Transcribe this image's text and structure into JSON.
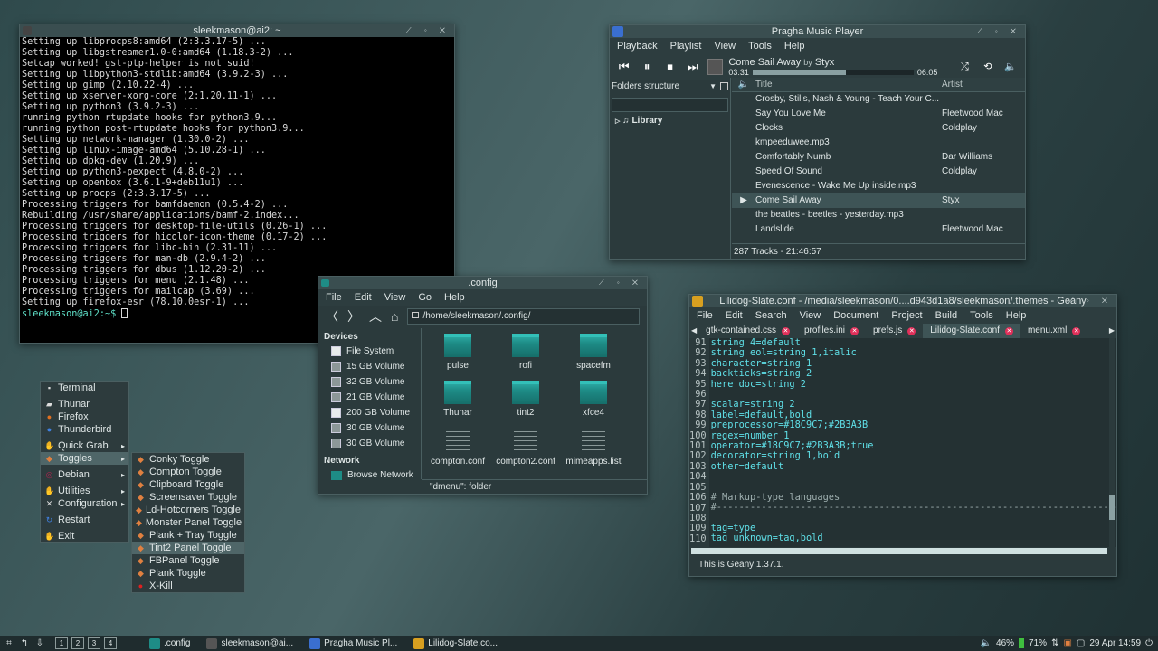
{
  "terminal": {
    "title": "sleekmason@ai2: ~",
    "lines": [
      "Setting up libprocps8:amd64 (2:3.3.17-5) ...",
      "Setting up libgstreamer1.0-0:amd64 (1.18.3-2) ...",
      "Setcap worked! gst-ptp-helper is not suid!",
      "Setting up libpython3-stdlib:amd64 (3.9.2-3) ...",
      "Setting up gimp (2.10.22-4) ...",
      "Setting up xserver-xorg-core (2:1.20.11-1) ...",
      "Setting up python3 (3.9.2-3) ...",
      "running python rtupdate hooks for python3.9...",
      "running python post-rtupdate hooks for python3.9...",
      "Setting up network-manager (1.30.0-2) ...",
      "Setting up linux-image-amd64 (5.10.28-1) ...",
      "Setting up dpkg-dev (1.20.9) ...",
      "Setting up python3-pexpect (4.8.0-2) ...",
      "Setting up openbox (3.6.1-9+deb11u1) ...",
      "Setting up procps (2:3.3.17-5) ...",
      "Processing triggers for bamfdaemon (0.5.4-2) ...",
      "Rebuilding /usr/share/applications/bamf-2.index...",
      "Processing triggers for desktop-file-utils (0.26-1) ...",
      "Processing triggers for hicolor-icon-theme (0.17-2) ...",
      "Processing triggers for libc-bin (2.31-11) ...",
      "Processing triggers for man-db (2.9.4-2) ...",
      "Processing triggers for dbus (1.12.20-2) ...",
      "Processing triggers for menu (2.1.48) ...",
      "Processing triggers for mailcap (3.69) ...",
      "Setting up firefox-esr (78.10.0esr-1) ..."
    ],
    "prompt": "sleekmason@ai2:~$"
  },
  "music": {
    "title": "Pragha Music Player",
    "menu": [
      "Playback",
      "Playlist",
      "View",
      "Tools",
      "Help"
    ],
    "now_title": "Come Sail Away",
    "now_by": "by",
    "now_artist": "Styx",
    "elapsed": "03:31",
    "total": "06:05",
    "progress": 0.58,
    "side_label": "Folders structure",
    "library": "Library",
    "col_title": "Title",
    "col_artist": "Artist",
    "tracks": [
      {
        "title": "Crosby, Stills, Nash & Young - Teach Your C...",
        "artist": ""
      },
      {
        "title": "Say You Love Me",
        "artist": "Fleetwood Mac"
      },
      {
        "title": "Clocks",
        "artist": "Coldplay"
      },
      {
        "title": "kmpeeduwee.mp3",
        "artist": ""
      },
      {
        "title": "Comfortably Numb",
        "artist": "Dar Williams"
      },
      {
        "title": "Speed Of Sound",
        "artist": "Coldplay"
      },
      {
        "title": "Evenescence - Wake Me Up inside.mp3",
        "artist": ""
      },
      {
        "title": "Come Sail Away",
        "artist": "Styx"
      },
      {
        "title": "the beatles - beetles - yesterday.mp3",
        "artist": ""
      },
      {
        "title": "Landslide",
        "artist": "Fleetwood Mac"
      }
    ],
    "playing_index": 7,
    "status": "287 Tracks - 21:46:57"
  },
  "files": {
    "title": ".config",
    "menu": [
      "File",
      "Edit",
      "View",
      "Go",
      "Help"
    ],
    "path": "/home/sleekmason/.config/",
    "devices_header": "Devices",
    "devices": [
      "File System",
      "15 GB Volume",
      "32 GB Volume",
      "21 GB Volume",
      "200 GB Volume",
      "30 GB Volume",
      "30 GB Volume"
    ],
    "network_header": "Network",
    "network_item": "Browse Network",
    "items": [
      {
        "name": "pulse",
        "kind": "folder"
      },
      {
        "name": "rofi",
        "kind": "folder"
      },
      {
        "name": "spacefm",
        "kind": "folder"
      },
      {
        "name": "Thunar",
        "kind": "folder"
      },
      {
        "name": "tint2",
        "kind": "folder"
      },
      {
        "name": "xfce4",
        "kind": "folder"
      },
      {
        "name": "compton.conf",
        "kind": "file"
      },
      {
        "name": "compton2.conf",
        "kind": "file"
      },
      {
        "name": "mimeapps.list",
        "kind": "file"
      }
    ],
    "status": "\"dmenu\": folder"
  },
  "geany": {
    "title": "Lilidog-Slate.conf - /media/sleekmason/0....d943d1a8/sleekmason/.themes - Geany",
    "menu": [
      "File",
      "Edit",
      "Search",
      "View",
      "Document",
      "Project",
      "Build",
      "Tools",
      "Help"
    ],
    "tabs": [
      "gtk-contained.css",
      "profiles.ini",
      "prefs.js",
      "Lilidog-Slate.conf",
      "menu.xml"
    ],
    "active_tab": 3,
    "line_numbers": [
      "91",
      "92",
      "93",
      "94",
      "95",
      "96",
      "97",
      "98",
      "99",
      "100",
      "101",
      "102",
      "103",
      "104",
      "105",
      "106",
      "107",
      "108",
      "109",
      "110"
    ],
    "code": [
      "string 4=default",
      "string eol=string 1,italic",
      "character=string 1",
      "backticks=string 2",
      "here doc=string 2",
      "",
      "scalar=string 2",
      "label=default,bold",
      "preprocessor=#18C9C7;#2B3A3B",
      "regex=number 1",
      "operator=#18C9C7;#2B3A3B;true",
      "decorator=string 1,bold",
      "other=default",
      "",
      "",
      "# Markup-type languages",
      "#-----------------------------------------------------------------------------------",
      "",
      "tag=type",
      "tag unknown=tag,bold"
    ],
    "status": "This is Geany 1.37.1."
  },
  "rootmenu": {
    "items": [
      {
        "label": "Terminal",
        "icon": "terminal-icon",
        "submenu": false,
        "sep_after": true
      },
      {
        "label": "Thunar",
        "icon": "file-manager-icon",
        "submenu": false,
        "sep_after": false
      },
      {
        "label": "Firefox",
        "icon": "firefox-icon",
        "submenu": false,
        "sep_after": false
      },
      {
        "label": "Thunderbird",
        "icon": "thunderbird-icon",
        "submenu": false,
        "sep_after": true
      },
      {
        "label": "Quick Grab",
        "icon": "grab-icon",
        "submenu": true,
        "sep_after": false
      },
      {
        "label": "Toggles",
        "icon": "toggle-icon",
        "submenu": true,
        "sep_after": true,
        "selected": true
      },
      {
        "label": "Debian",
        "icon": "debian-icon",
        "submenu": true,
        "sep_after": true
      },
      {
        "label": "Utilities",
        "icon": "utilities-icon",
        "submenu": true,
        "sep_after": false
      },
      {
        "label": "Configuration",
        "icon": "configuration-icon",
        "submenu": true,
        "sep_after": true
      },
      {
        "label": "Restart",
        "icon": "restart-icon",
        "submenu": false,
        "sep_after": true
      },
      {
        "label": "Exit",
        "icon": "exit-icon",
        "submenu": false,
        "sep_after": false
      }
    ],
    "toggles": [
      "Conky Toggle",
      "Compton Toggle",
      "Clipboard Toggle",
      "Screensaver Toggle",
      "Ld-Hotcorners Toggle",
      "Monster Panel Toggle",
      "Plank + Tray Toggle",
      "Tint2 Panel Toggle",
      "FBPanel Toggle",
      "Plank Toggle",
      "X-Kill"
    ],
    "toggle_selected": 7
  },
  "taskbar": {
    "desktops": [
      "1",
      "2",
      "3",
      "4"
    ],
    "tasks": [
      {
        "label": ".config",
        "color": "#1e8c86"
      },
      {
        "label": "sleekmason@ai...",
        "color": "#555555"
      },
      {
        "label": "Pragha Music Pl...",
        "color": "#3a6fd0"
      },
      {
        "label": "Lilidog-Slate.co...",
        "color": "#d8a020"
      }
    ],
    "volume": "46%",
    "battery": "71%",
    "clock": "29 Apr 14:59"
  },
  "colors": {
    "accent": "#18C9C7",
    "close_tab": "#e0305a"
  }
}
